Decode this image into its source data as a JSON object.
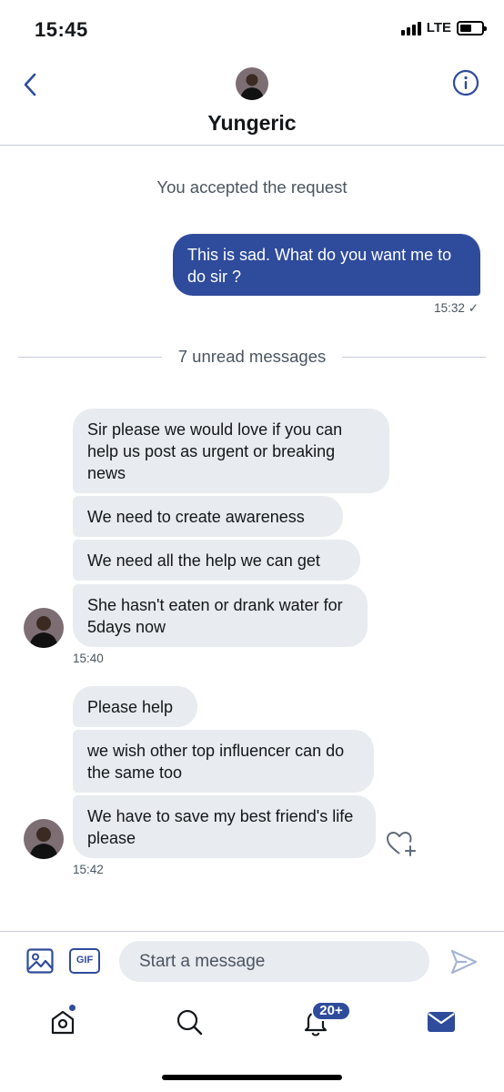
{
  "status_bar": {
    "time": "15:45",
    "network": "LTE",
    "signal_bars": 4,
    "battery_level": 0.55
  },
  "header": {
    "contact_name": "Yungeric",
    "back_icon": "chevron-left-icon",
    "info_icon": "info-icon"
  },
  "conversation": {
    "system_message": "You accepted the request",
    "sent": {
      "text": "This is sad. What do you want me to do sir ?",
      "time": "15:32",
      "receipt": "✓"
    },
    "unread_divider": "7 unread messages",
    "group1": {
      "messages": [
        "Sir please we would love if you can help us post as urgent or breaking news",
        "We need to create awareness",
        "We need all the help we can get",
        "She hasn't eaten or drank water for 5days now"
      ],
      "time": "15:40"
    },
    "group2": {
      "messages": [
        "Please help",
        "we wish other top influencer can do the same too",
        "We have to save my best friend's life please"
      ],
      "time": "15:42"
    }
  },
  "composer": {
    "placeholder": "Start a message",
    "gif_label": "GIF"
  },
  "tab_bar": {
    "notifications_badge": "20+",
    "has_home_update": true
  },
  "colors": {
    "accent": "#2f4b9c",
    "bubble_incoming": "#e8ebef",
    "secondary_text": "#4a5561"
  }
}
